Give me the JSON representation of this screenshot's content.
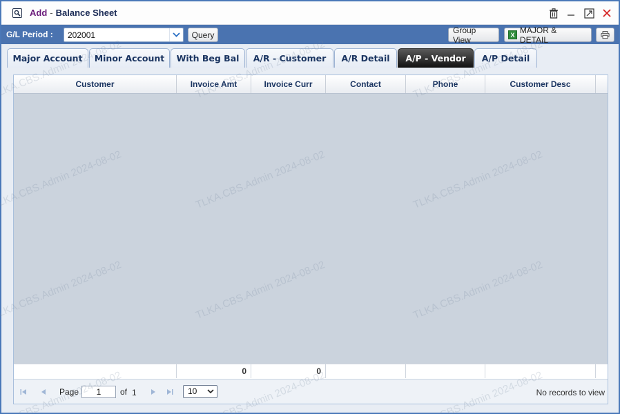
{
  "window": {
    "title_action": "Add",
    "title_separator": "-",
    "title_name": "Balance Sheet"
  },
  "toolbar": {
    "gl_label": "G/L Period :",
    "gl_value": "202001",
    "query_label": "Query",
    "group_view_label": "Group View",
    "major_detail_label": "MAJOR & DETAIL"
  },
  "tabs": [
    {
      "label": "Major Account",
      "active": false
    },
    {
      "label": "Minor Account",
      "active": false
    },
    {
      "label": "With Beg Bal",
      "active": false
    },
    {
      "label": "A/R - Customer",
      "active": false
    },
    {
      "label": "A/R Detail",
      "active": false
    },
    {
      "label": "A/P - Vendor",
      "active": true
    },
    {
      "label": "A/P Detail",
      "active": false
    }
  ],
  "grid": {
    "columns": [
      "Customer",
      "Invoice Amt",
      "Invoice Curr",
      "Contact",
      "Phone",
      "Customer Desc"
    ],
    "footer": {
      "invoice_amt_total": "0",
      "invoice_curr_total": "0"
    }
  },
  "pager": {
    "page_label": "Page",
    "page_value": "1",
    "of_label": "of",
    "total_pages": "1",
    "page_size": "10",
    "status": "No records to view"
  },
  "watermark_text": "TLKA.CBS.Admin 2024-08-02",
  "colors": {
    "toolbar_bg": "#4a73b0",
    "active_tab_bg": "#111111",
    "grid_body_bg": "#cbd3dd",
    "close_red": "#d42020"
  }
}
